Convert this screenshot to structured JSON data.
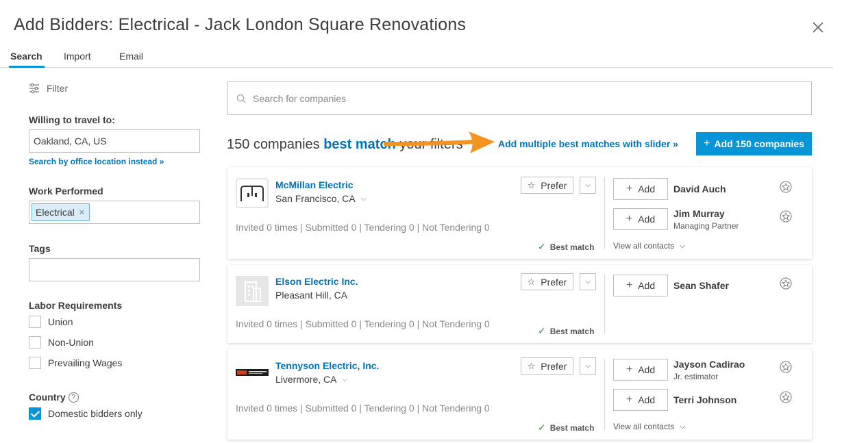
{
  "dialog": {
    "title": "Add Bidders: Electrical - Jack London Square Renovations"
  },
  "tabs": [
    {
      "label": "Search",
      "active": true
    },
    {
      "label": "Import",
      "active": false
    },
    {
      "label": "Email",
      "active": false
    }
  ],
  "sidebar": {
    "filter_label": "Filter",
    "travel_label": "Willing to travel to:",
    "travel_value": "Oakland, CA, US",
    "office_link": "Search by office location instead »",
    "work_label": "Work Performed",
    "work_chip": "Electrical",
    "tags_label": "Tags",
    "labor_label": "Labor Requirements",
    "labor_options": [
      "Union",
      "Non-Union",
      "Prevailing Wages"
    ],
    "country_label": "Country",
    "country_option": "Domestic bidders only",
    "country_checked": true
  },
  "main": {
    "search_placeholder": "Search for companies",
    "count_prefix": "150 companies",
    "count_match": "best match",
    "count_suffix": "your filters",
    "slider_link": "Add multiple best matches with slider »",
    "add_all_label": "Add 150 companies"
  },
  "prefer_label": "Prefer",
  "add_label": "Add",
  "view_all_label": "View all contacts",
  "best_match_label": "Best match",
  "companies": [
    {
      "name": "McMillan Electric",
      "location": "San Francisco, CA",
      "stats": "Invited 0 times | Submitted 0 | Tendering 0 | Not Tendering 0",
      "contacts": [
        {
          "name": "David Auch",
          "role": ""
        },
        {
          "name": "Jim Murray",
          "role": "Managing Partner"
        }
      ]
    },
    {
      "name": "Elson Electric Inc.",
      "location": "Pleasant Hill, CA",
      "stats": "Invited 0 times | Submitted 0 | Tendering 0 | Not Tendering 0",
      "contacts": [
        {
          "name": "Sean Shafer",
          "role": ""
        }
      ]
    },
    {
      "name": "Tennyson Electric, Inc.",
      "location": "Livermore, CA",
      "stats": "Invited 0 times | Submitted 0 | Tendering 0 | Not Tendering 0",
      "contacts": [
        {
          "name": "Jayson Cadirao",
          "role": "Jr. estimator"
        },
        {
          "name": "Terri Johnson",
          "role": ""
        }
      ]
    }
  ],
  "colors": {
    "accent": "#0696d7",
    "link": "#0073b7",
    "arrow": "#f39420"
  }
}
